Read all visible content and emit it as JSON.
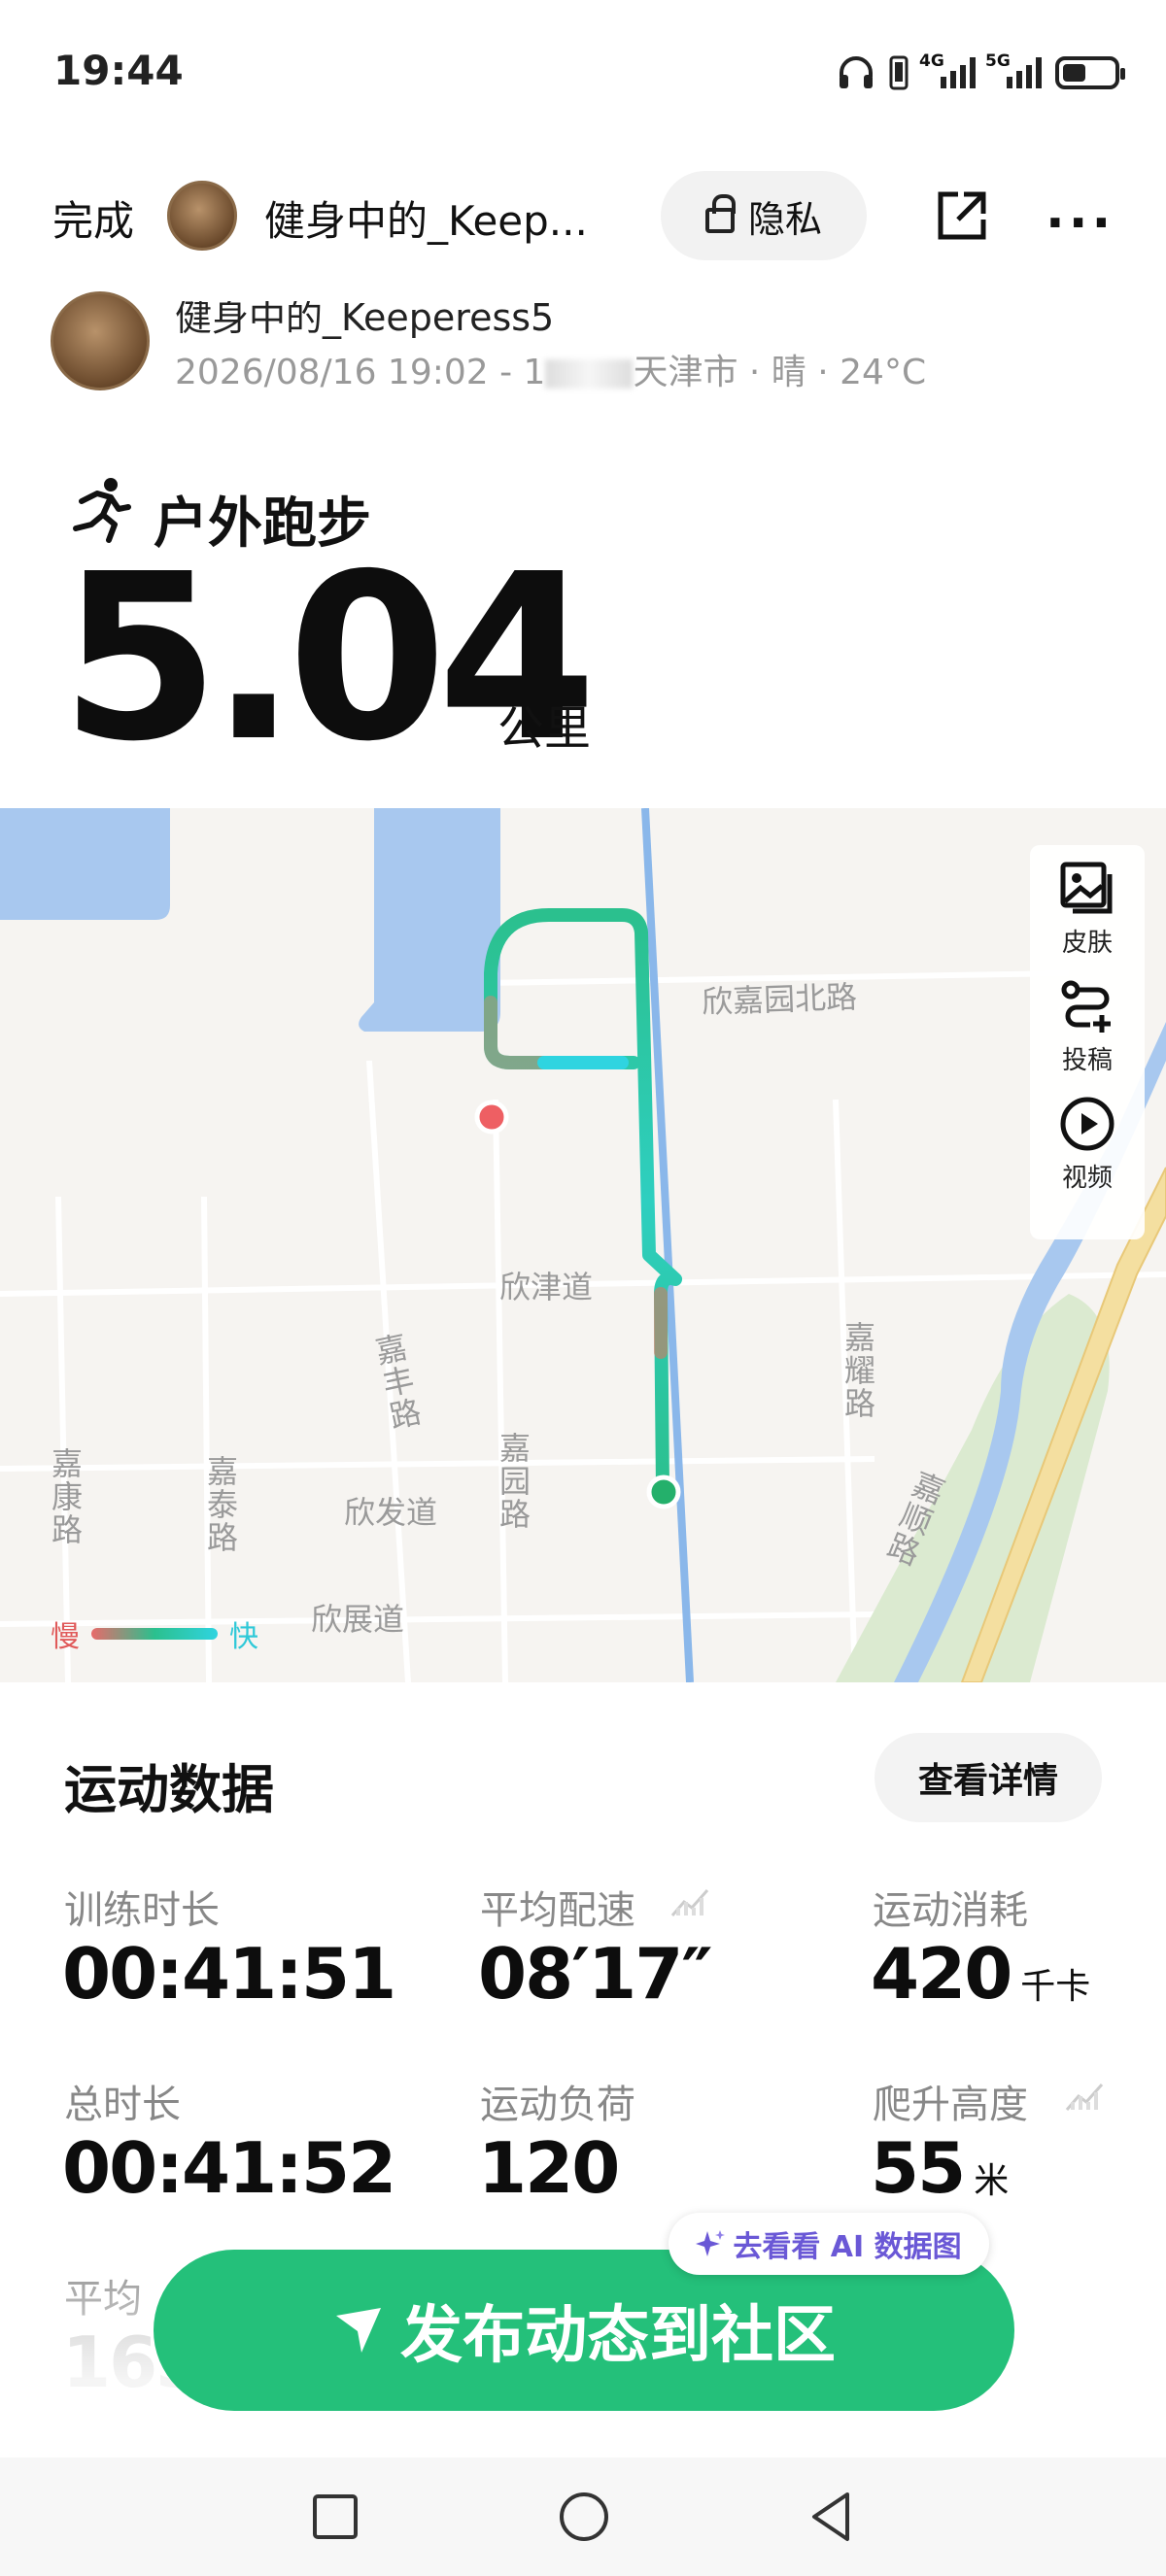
{
  "status_bar": {
    "time": "19:44",
    "network_1": "4G",
    "network_2": "5G"
  },
  "header": {
    "done_label": "完成",
    "username": "健身中的_Keep...",
    "privacy_label": "隐私"
  },
  "workout_info": {
    "username": "健身中的_Keeperess5",
    "date_time": "2026/08/16 19:02 - 1",
    "location_weather": "天津市 · 晴 · 24°C"
  },
  "sport": {
    "title": "户外跑步",
    "distance": "5.04",
    "unit": "公里"
  },
  "map": {
    "labels": {
      "xinjiayuan_north_rd": "欣嘉园北路",
      "xinjin_rd": "欣津道",
      "jiafeng_rd": "嘉丰路",
      "jiayuan_rd": "嘉园路",
      "jiayao_rd": "嘉耀路",
      "jiashun_rd": "嘉顺路",
      "jiakang_rd": "嘉康路",
      "jiatai_rd": "嘉泰路",
      "xinfa_rd": "欣发道",
      "xinzhan_rd": "欣展道"
    },
    "tools": [
      "皮肤",
      "投稿",
      "视频"
    ],
    "legend_slow": "慢",
    "legend_fast": "快",
    "route_colors": {
      "slow": "#e86a6a",
      "mid": "#2bc08e",
      "fast": "#2fd4e0"
    }
  },
  "stats": {
    "title": "运动数据",
    "detail_button": "查看详情",
    "items": [
      {
        "label": "训练时长",
        "value": "00:41:51",
        "unit": ""
      },
      {
        "label": "平均配速",
        "value": "08′17″",
        "unit": ""
      },
      {
        "label": "运动消耗",
        "value": "420",
        "unit": "千卡"
      },
      {
        "label": "总时长",
        "value": "00:41:52",
        "unit": ""
      },
      {
        "label": "运动负荷",
        "value": "120",
        "unit": ""
      },
      {
        "label": "爬升高度",
        "value": "55",
        "unit": "米"
      },
      {
        "label": "平均",
        "value": "163",
        "unit": ""
      }
    ]
  },
  "ai_pill": "去看看 AI 数据图",
  "publish_button": "发布动态到社区",
  "colors": {
    "accent": "#24c07a",
    "ai": "#6a58d6"
  }
}
